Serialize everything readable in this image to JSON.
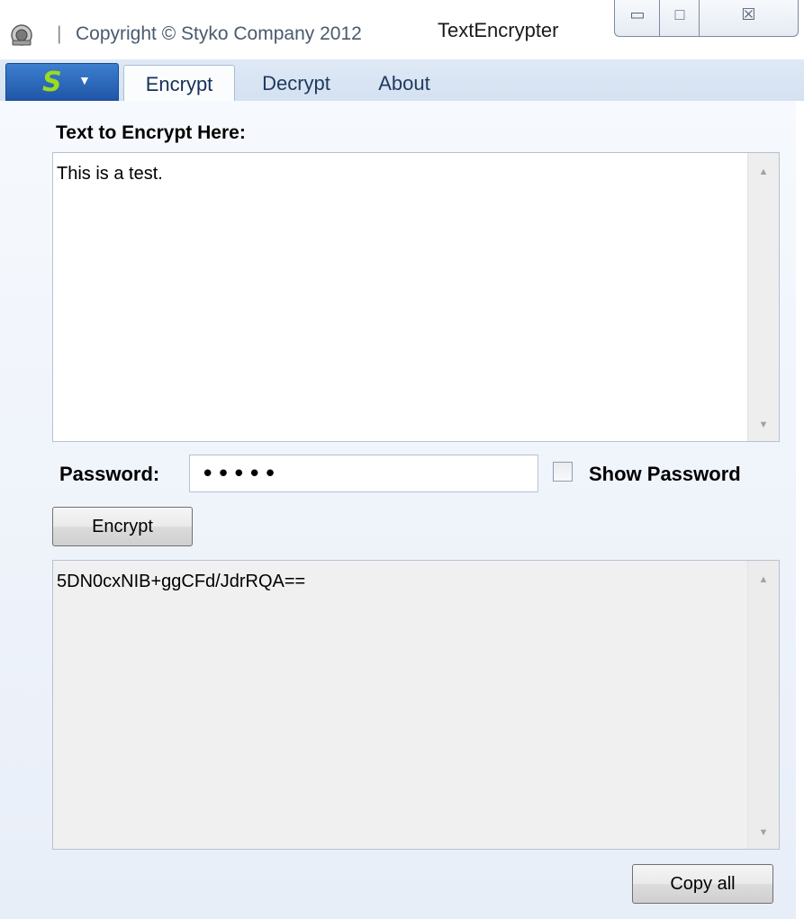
{
  "titlebar": {
    "separator": "|",
    "copyright": "Copyright © Styko Company 2012",
    "window_title": "TextEncrypter",
    "minimize_glyph": "▭",
    "maximize_glyph": "□",
    "close_glyph": "☒"
  },
  "ribbon": {
    "app_menu_logo": "S",
    "app_menu_caret": "▼",
    "tabs": [
      {
        "label": "Encrypt",
        "active": true
      },
      {
        "label": "Decrypt",
        "active": false
      },
      {
        "label": "About",
        "active": false
      }
    ]
  },
  "encrypt": {
    "input_label": "Text to Encrypt Here:",
    "input_text": "This is a test.",
    "password_label": "Password:",
    "password_value": "•••••",
    "show_password_label": "Show Password",
    "show_password_checked": false,
    "encrypt_button": "Encrypt",
    "output_text": "5DN0cxNIB+ggCFd/JdrRQA==",
    "copy_all_button": "Copy all"
  },
  "scroll": {
    "up_glyph": "▲",
    "down_glyph": "▼"
  },
  "colors": {
    "ribbon_bg": "#d4e1f1",
    "app_button": "#2a63b8",
    "logo": "#9bdc1f"
  }
}
